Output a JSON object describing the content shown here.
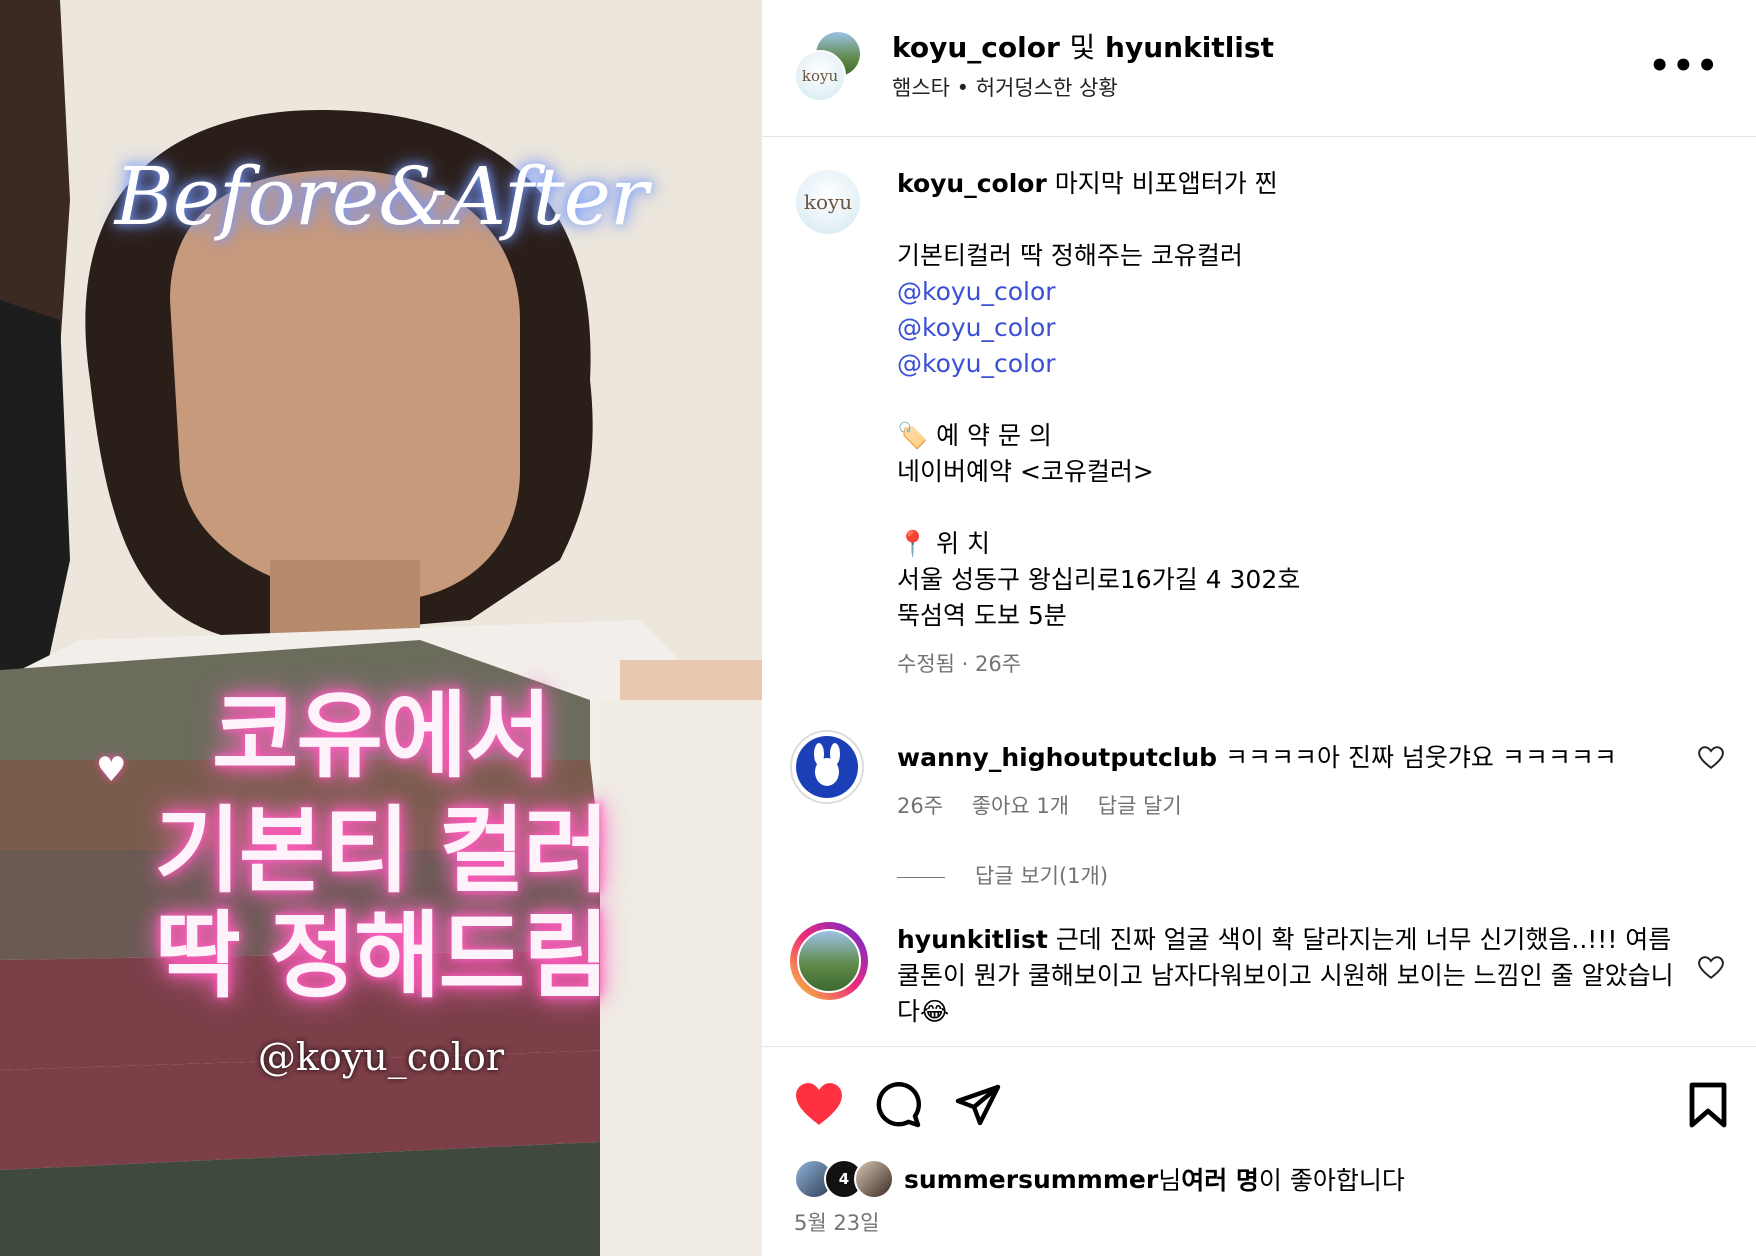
{
  "media": {
    "title": "Before&After",
    "lines": [
      "코유에서",
      "기본티 컬러",
      "딱 정해드림"
    ],
    "handle": "@koyu_color",
    "heart_icon": "♥"
  },
  "header": {
    "avatar_text": "koyu",
    "user1": "koyu_color",
    "and": "및",
    "user2": "hyunkitlist",
    "music": "햄스타",
    "dot": "•",
    "song": "허거덩스한 상황",
    "more": "•••"
  },
  "caption": {
    "avatar_text": "koyu",
    "username": "koyu_color",
    "first_line": "마지막 비포앱터가 찐",
    "line2": "기본티컬러 딱 정해주는 코유컬러",
    "links": [
      "@koyu_color",
      "@koyu_color",
      "@koyu_color"
    ],
    "reserve_icon": "🏷️",
    "reserve_title": "예 약 문 의",
    "reserve_body": "네이버예약 <코유컬러>",
    "location_icon": "📍",
    "location_title": "위 치",
    "address": "서울 성동구 왕십리로16가길 4 302호",
    "walk": "뚝섬역 도보 5분",
    "meta": "수정됨 · 26주"
  },
  "comments": [
    {
      "username": "wanny_highoutputclub",
      "text": "ㅋㅋㅋㅋ아 진짜 넘웃갸요 ㅋㅋㅋㅋㅋ",
      "time": "26주",
      "likes": "좋아요 1개",
      "reply": "답글 달기",
      "view_replies": "답글 보기(1개)"
    },
    {
      "username": "hyunkitlist",
      "text": "근데 진짜 얼굴 색이 확 달라지는게 너무 신기했음..!!! 여름쿨톤이 뭔가 쿨해보이고 남자다워보이고 시원해 보이는 느낌인 줄 알았습니다😂"
    }
  ],
  "actions": {
    "like_icon": "heart-filled",
    "liked_by_user": "summersummmer",
    "liked_by_suffix1": "님 ",
    "liked_by_many": "여러 명",
    "liked_by_suffix2": "이 좋아합니다",
    "mini_count": "4",
    "date": "5월 23일"
  },
  "colors": {
    "link": "#3b4fd6",
    "like_red": "#ff3040",
    "muted": "#737373"
  }
}
